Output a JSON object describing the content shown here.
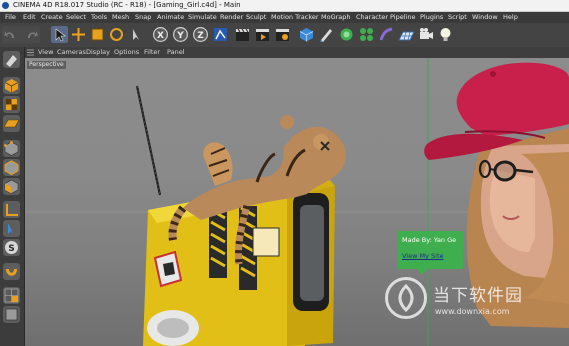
{
  "window": {
    "title": "CINEMA 4D R18.017 Studio (RC - R18) - [Gaming_Girl.c4d] - Main"
  },
  "menu": [
    "File",
    "Edit",
    "Create",
    "Select",
    "Tools",
    "Mesh",
    "Snap",
    "Animate",
    "Simulate",
    "Render",
    "Sculpt",
    "Motion Tracker",
    "MoGraph",
    "Character",
    "Pipeline",
    "Plugins",
    "Script",
    "Window",
    "Help"
  ],
  "toolbar": {
    "axis_x": "X",
    "axis_y": "Y",
    "axis_z": "Z"
  },
  "viewport": {
    "menu": [
      "View",
      "Cameras",
      "Display",
      "Options",
      "Filter",
      "Panel"
    ],
    "camera_label": "Perspective"
  },
  "tooltip": {
    "made_by": "Made By: Yan Ge",
    "link": "View My Site"
  },
  "watermark": {
    "name": "当下软件园",
    "url": "www.downxia.com"
  },
  "colors": {
    "tooltip_bg": "#3fae4e",
    "cap": "#c8204a",
    "robot_body": "#e6c21a"
  }
}
